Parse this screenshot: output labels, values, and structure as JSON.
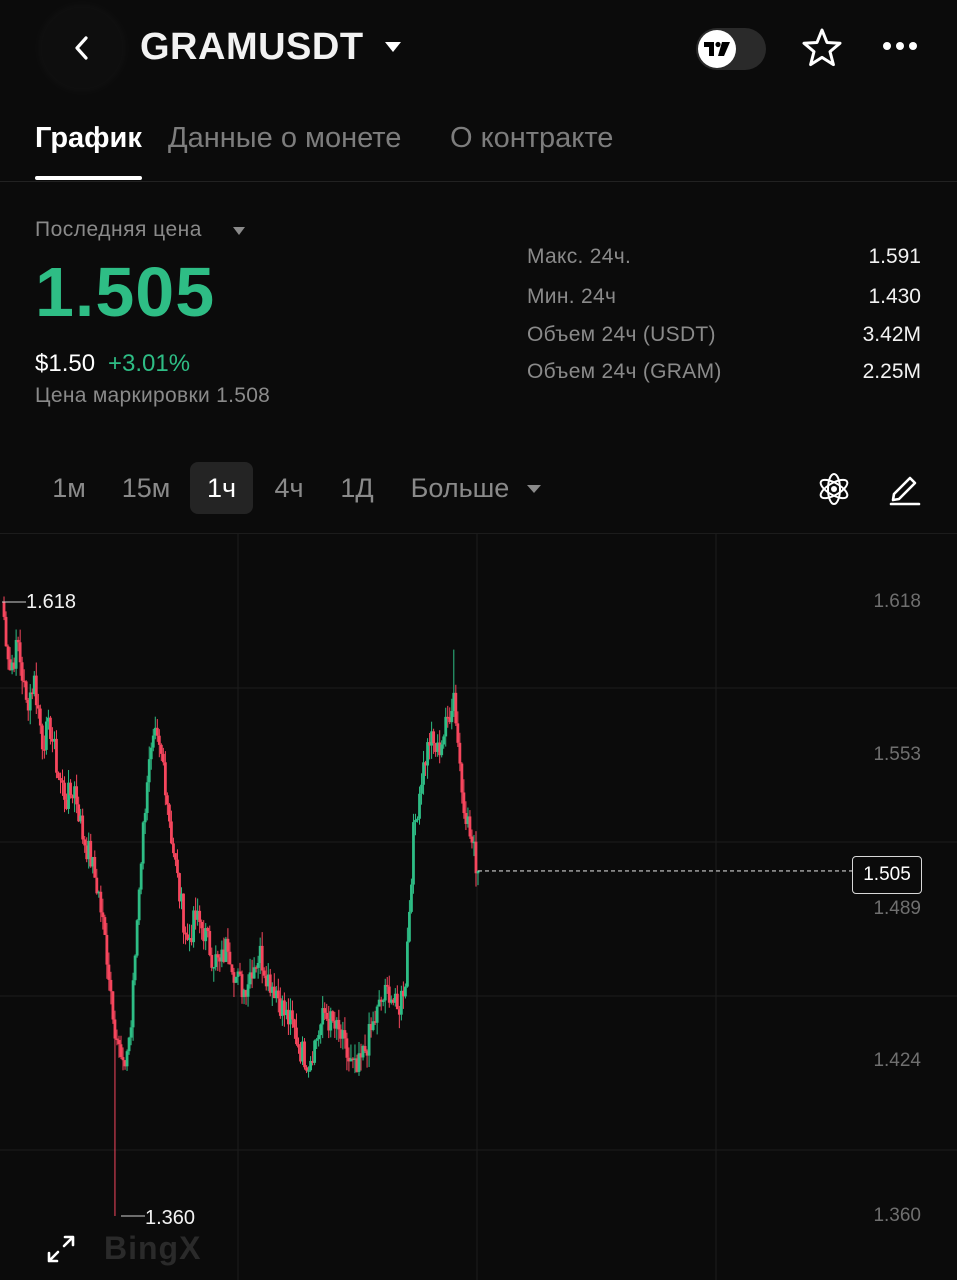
{
  "header": {
    "title": "GRAMUSDT",
    "back_icon": "chevron-left-icon",
    "toggle_icon": "tradingview-icon",
    "favorite_icon": "star-icon",
    "more_icon": "more-dots-icon"
  },
  "tabs": [
    {
      "label": "График",
      "active": true
    },
    {
      "label": "Данные о монете",
      "active": false
    },
    {
      "label": "О контракте",
      "active": false
    }
  ],
  "price": {
    "label": "Последняя цена",
    "last": "1.505",
    "usd": "$1.50",
    "change": "+3.01%",
    "mark": "Цена маркировки 1.508"
  },
  "stats": [
    {
      "label": "Макс. 24ч.",
      "value": "1.591"
    },
    {
      "label": "Мин. 24ч",
      "value": "1.430"
    },
    {
      "label": "Объем 24ч (USDT)",
      "value": "3.42M"
    },
    {
      "label": "Объем 24ч (GRAM)",
      "value": "2.25M"
    }
  ],
  "intervals": [
    {
      "label": "1м",
      "active": false
    },
    {
      "label": "15м",
      "active": false
    },
    {
      "label": "1ч",
      "active": true
    },
    {
      "label": "4ч",
      "active": false
    },
    {
      "label": "1Д",
      "active": false
    }
  ],
  "more_label": "Больше",
  "colors": {
    "up": "#2ebd85",
    "down": "#f6465d",
    "background": "#0b0b0b"
  },
  "chart_data": {
    "type": "candlestick",
    "y_ticks": [
      "1.618",
      "1.553",
      "1.489",
      "1.424",
      "1.360"
    ],
    "ylim": [
      1.36,
      1.618
    ],
    "high_label": "1.618",
    "low_label": "1.360",
    "current_price": "1.505",
    "grid": true,
    "close_path": [
      1.618,
      1.59,
      1.6,
      1.575,
      1.585,
      1.56,
      1.565,
      1.545,
      1.535,
      1.54,
      1.52,
      1.51,
      1.495,
      1.47,
      1.44,
      1.42,
      1.44,
      1.5,
      1.545,
      1.56,
      1.55,
      1.52,
      1.495,
      1.475,
      1.485,
      1.48,
      1.47,
      1.465,
      1.475,
      1.46,
      1.455,
      1.465,
      1.47,
      1.46,
      1.455,
      1.445,
      1.44,
      1.43,
      1.425,
      1.435,
      1.445,
      1.44,
      1.435,
      1.425,
      1.42,
      1.43,
      1.44,
      1.45,
      1.455,
      1.445,
      1.46,
      1.52,
      1.545,
      1.56,
      1.555,
      1.565,
      1.58,
      1.54,
      1.52,
      1.505
    ],
    "low_extremes": [
      {
        "index": 14,
        "value": 1.36
      }
    ],
    "high_extremes": [
      {
        "index": 0,
        "value": 1.618
      },
      {
        "index": 56,
        "value": 1.598
      }
    ]
  },
  "watermark": "BingX",
  "expand_icon": "expand-arrows-icon",
  "indicator_icon": "atom-icon",
  "draw_icon": "pencil-icon"
}
